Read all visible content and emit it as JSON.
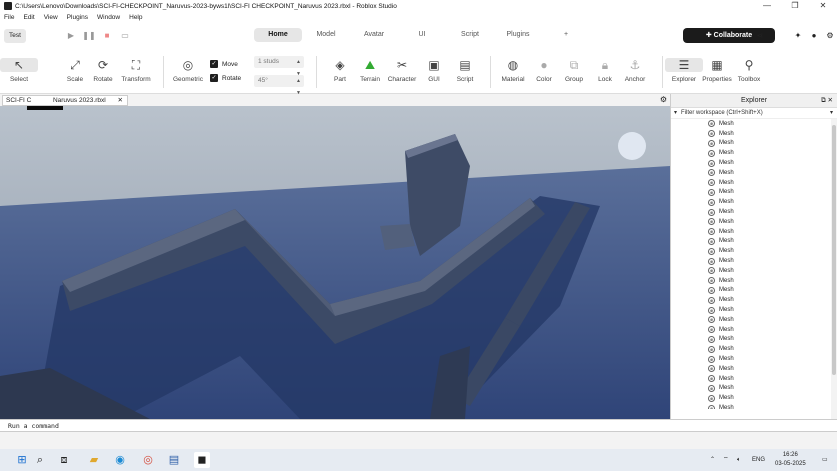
{
  "window": {
    "title": "C:\\Users\\Lenovo\\Downloads\\SCI-FI-CHECKPOINT_Naruvus-2023-byws1l\\SCI-FI CHECKPOINT_Naruvus 2023.rbxl - Roblox Studio",
    "minimize": "—",
    "maximize": "❐",
    "close": "✕"
  },
  "menu": [
    "File",
    "Edit",
    "View",
    "Plugins",
    "Window",
    "Help"
  ],
  "topbar": {
    "test_label": "Test",
    "tabs": [
      "Home",
      "Model",
      "Avatar",
      "UI",
      "Script",
      "Plugins",
      "+"
    ],
    "active_tab": "Home",
    "collaborate_label": "Collaborate"
  },
  "toolbar": {
    "tools_left": [
      {
        "label": "Select",
        "icon": "cursor-icon"
      },
      {
        "label": "Scale",
        "icon": "scale-icon"
      },
      {
        "label": "Rotate",
        "icon": "rotate-icon"
      },
      {
        "label": "Transform",
        "icon": "transform-icon"
      }
    ],
    "geometric_label": "Geometric",
    "move_label": "Move",
    "rotate_check_label": "Rotate",
    "studs_value": "1 studs",
    "angle_value": "45°",
    "tools_mid": [
      {
        "label": "Part"
      },
      {
        "label": "Terrain"
      },
      {
        "label": "Character"
      },
      {
        "label": "GUI"
      },
      {
        "label": "Script"
      }
    ],
    "tools_right": [
      {
        "label": "Material"
      },
      {
        "label": "Color"
      },
      {
        "label": "Group"
      },
      {
        "label": "Lock"
      },
      {
        "label": "Anchor"
      }
    ],
    "tools_panels": [
      {
        "label": "Explorer"
      },
      {
        "label": "Properties"
      },
      {
        "label": "Toolbox"
      }
    ]
  },
  "document_tab": {
    "label": "SCI-FI C            Naruvus 2023.rbxl",
    "close": "✕"
  },
  "brightness": {
    "level": 0.45
  },
  "explorer": {
    "title": "Explorer",
    "filter_placeholder": "Filter workspace (Ctrl+Shift+X)",
    "items": [
      "Mesh",
      "Mesh",
      "Mesh",
      "Mesh",
      "Mesh",
      "Mesh",
      "Mesh",
      "Mesh",
      "Mesh",
      "Mesh",
      "Mesh",
      "Mesh",
      "Mesh",
      "Mesh",
      "Mesh",
      "Mesh",
      "Mesh",
      "Mesh",
      "Mesh",
      "Mesh",
      "Mesh",
      "Mesh",
      "Mesh",
      "Mesh",
      "Mesh",
      "Mesh",
      "Mesh",
      "Mesh",
      "Mesh",
      "Mesh"
    ]
  },
  "command_bar": {
    "placeholder": "Run a command"
  },
  "taskbar": {
    "lang": "ENG",
    "time": "16:26",
    "date": "03-05-2025"
  }
}
